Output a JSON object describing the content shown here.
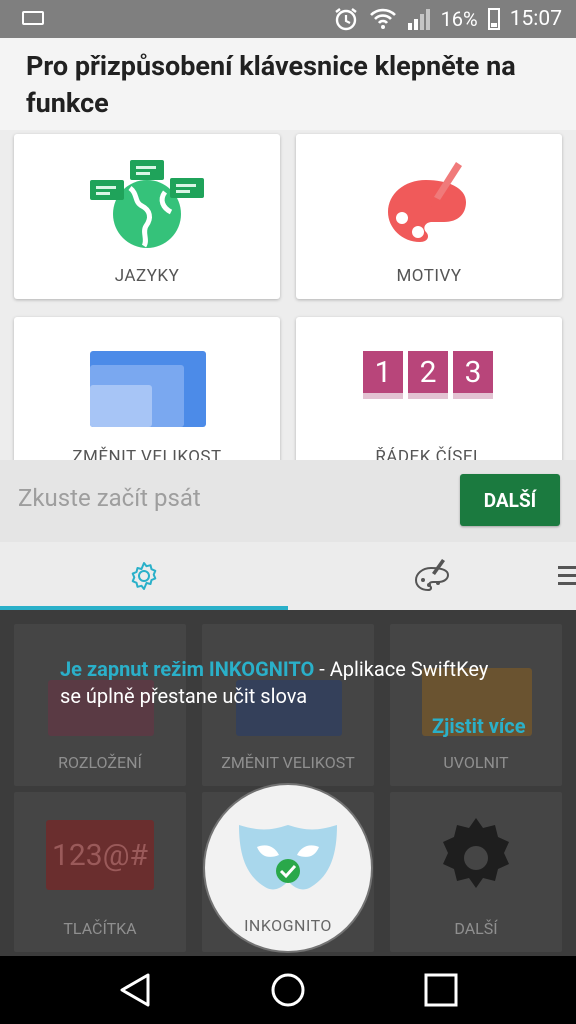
{
  "status_bar": {
    "battery": "16%",
    "time": "15:07"
  },
  "header": {
    "title": "Pro přizpůsobení klávesnice klepněte na funkce"
  },
  "features": [
    {
      "label": "JAZYKY"
    },
    {
      "label": "MOTIVY"
    },
    {
      "label": "ZMĚNIT VELIKOST"
    },
    {
      "label": "ŘÁDEK ČÍSEL"
    }
  ],
  "number_row": {
    "digits": [
      "1",
      "2",
      "3"
    ]
  },
  "input": {
    "placeholder": "Zkuste začít psát"
  },
  "next_button": {
    "label": "DALŠÍ"
  },
  "panel": {
    "items": [
      {
        "label": "ROZLOŽENÍ"
      },
      {
        "label": "ZMĚNIT VELIKOST"
      },
      {
        "label": "UVOLNIT"
      },
      {
        "label": "TLAČÍTKA"
      },
      {
        "label": "INKOGNITO"
      },
      {
        "label": "DALŠÍ"
      }
    ],
    "buttons_glyphs": "123@#"
  },
  "incognito_message": {
    "highlight": "Je zapnut režim INKOGNITO",
    "text": " - Aplikace SwiftKey se úplně přestane učit slova",
    "more": "Zjistit více"
  },
  "colors": {
    "accent": "#2ab0c9",
    "next_button": "#1b7a3f",
    "theme_red": "#f05a5a",
    "number_key": "#b8457a"
  }
}
